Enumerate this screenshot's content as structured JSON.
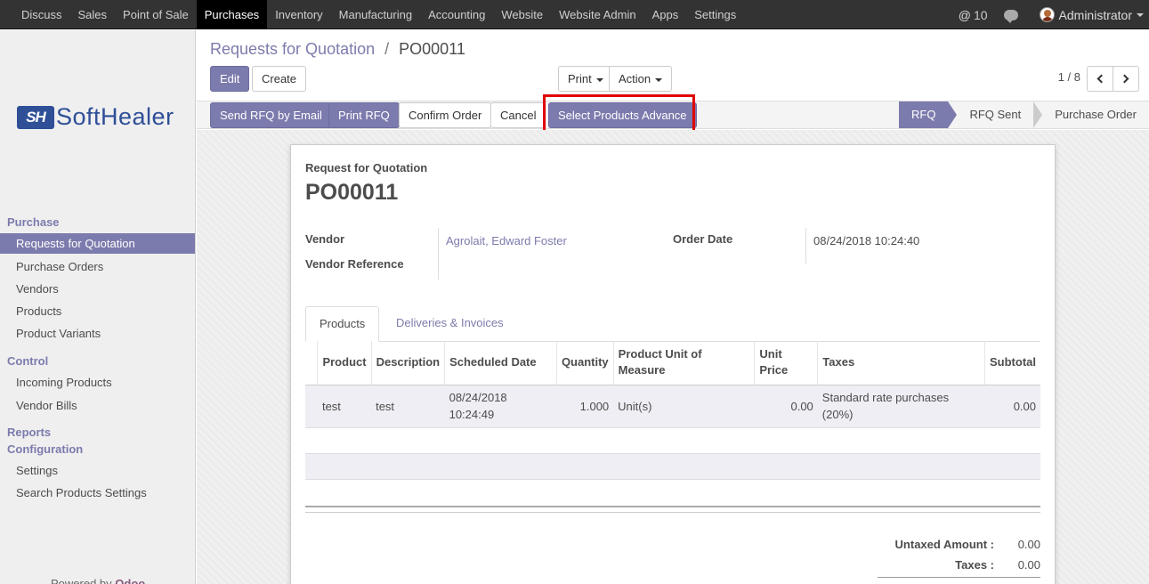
{
  "topbar": {
    "menu": [
      "Discuss",
      "Sales",
      "Point of Sale",
      "Purchases",
      "Inventory",
      "Manufacturing",
      "Accounting",
      "Website",
      "Website Admin",
      "Apps",
      "Settings"
    ],
    "active_menu": "Purchases",
    "messages_count": "10",
    "user_name": "Administrator"
  },
  "sidebar": {
    "logo_mark": "SH",
    "logo_text": "SoftHealer",
    "sections": {
      "purchase": "Purchase",
      "control": "Control",
      "reports": "Reports",
      "configuration": "Configuration"
    },
    "items": {
      "rfq": "Requests for Quotation",
      "purchase_orders": "Purchase Orders",
      "vendors": "Vendors",
      "products": "Products",
      "product_variants": "Product Variants",
      "incoming_products": "Incoming Products",
      "vendor_bills": "Vendor Bills",
      "settings": "Settings",
      "search_products_settings": "Search Products Settings"
    },
    "powered_by": "Powered by",
    "powered_brand": "Odoo"
  },
  "control_panel": {
    "breadcrumb_parent": "Requests for Quotation",
    "breadcrumb_sep": "/",
    "breadcrumb_current": "PO00011",
    "edit_label": "Edit",
    "create_label": "Create",
    "print_label": "Print",
    "action_label": "Action",
    "pager": "1 / 8"
  },
  "statusbar": {
    "send_rfq_email": "Send RFQ by Email",
    "print_rfq": "Print RFQ",
    "confirm_order": "Confirm Order",
    "cancel": "Cancel",
    "select_products_advance": "Select Products Advance",
    "stages": [
      "RFQ",
      "RFQ Sent",
      "Purchase Order"
    ],
    "current_stage": "RFQ"
  },
  "form": {
    "doc_label": "Request for Quotation",
    "doc_name": "PO00011",
    "vendor_label": "Vendor",
    "vendor_value": "Agrolait, Edward Foster",
    "vendor_ref_label": "Vendor Reference",
    "order_date_label": "Order Date",
    "order_date_value": "08/24/2018 10:24:40",
    "tabs": [
      "Products",
      "Deliveries & Invoices"
    ],
    "columns": {
      "product": "Product",
      "description": "Description",
      "scheduled_date": "Scheduled Date",
      "quantity": "Quantity",
      "uom_line1": "Product Unit of",
      "uom_line2": "Measure",
      "price_line1": "Unit",
      "price_line2": "Price",
      "taxes": "Taxes",
      "subtotal": "Subtotal"
    },
    "line": {
      "product": "test",
      "description": "test",
      "scheduled_date_line1": "08/24/2018",
      "scheduled_date_line2": "10:24:49",
      "quantity": "1.000",
      "uom": "Unit(s)",
      "unit_price": "0.00",
      "taxes_line1": "Standard rate purchases",
      "taxes_line2": "(20%)",
      "subtotal": "0.00"
    },
    "totals": {
      "untaxed_label": "Untaxed Amount :",
      "untaxed_value": "0.00",
      "taxes_label": "Taxes :",
      "taxes_value": "0.00"
    }
  },
  "colors": {
    "accent": "#7c7bad",
    "topbar": "#333333",
    "highlight_box": "#e00000",
    "odoo_brand": "#875a7b"
  }
}
